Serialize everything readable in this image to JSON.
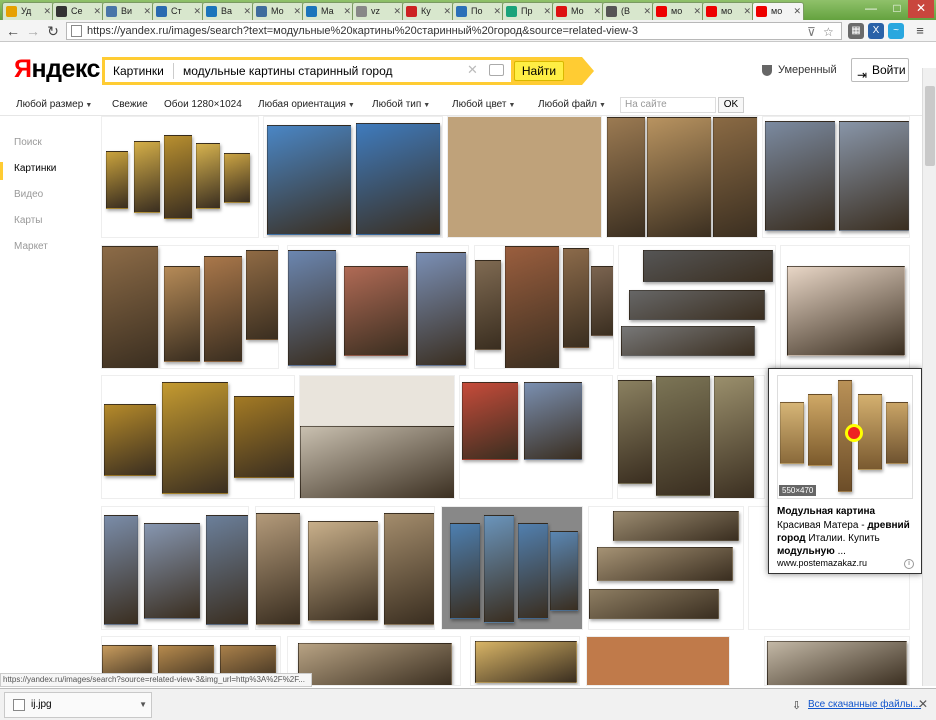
{
  "browser": {
    "tabs": [
      {
        "label": "Уд",
        "color": "#e6a100"
      },
      {
        "label": "Се",
        "color": "#333"
      },
      {
        "label": "Ви",
        "color": "#4a76a8"
      },
      {
        "label": "Ст",
        "color": "#2a6bb0"
      },
      {
        "label": "Ва",
        "color": "#1b75bb"
      },
      {
        "label": "Мо",
        "color": "#3f6d9d"
      },
      {
        "label": "Ма",
        "color": "#1b75bb"
      },
      {
        "label": "vz",
        "color": "#888"
      },
      {
        "label": "Ку",
        "color": "#cc2222"
      },
      {
        "label": "По",
        "color": "#2b71b8"
      },
      {
        "label": "Пр",
        "color": "#1aa37a"
      },
      {
        "label": "Мо",
        "color": "#d11"
      },
      {
        "label": "(В",
        "color": "#555"
      },
      {
        "label": "мо",
        "color": "#e00"
      },
      {
        "label": "мо",
        "color": "#e00"
      },
      {
        "label": "мо",
        "color": "#e00"
      }
    ],
    "url": "https://yandex.ru/images/search?text=модульные%20картины%20старинный%20город&source=related-view-3",
    "window_buttons": {
      "minimize": "—",
      "maximize": "□",
      "close": "✕"
    }
  },
  "header": {
    "logo_first": "Я",
    "logo_rest": "ндекс",
    "service": "Картинки",
    "query": "модульные картины старинный город",
    "find_button": "Найти",
    "safe_search": "Умеренный",
    "login": "Войти"
  },
  "filters": {
    "items": [
      {
        "label": "Любой размер",
        "chev": true
      },
      {
        "label": "Свежие",
        "chev": false
      },
      {
        "label": "Обои 1280×1024",
        "chev": false
      },
      {
        "label": "Любая ориентация",
        "chev": true
      },
      {
        "label": "Любой тип",
        "chev": true
      },
      {
        "label": "Любой цвет",
        "chev": true
      },
      {
        "label": "Любой файл",
        "chev": true
      }
    ],
    "site_placeholder": "На сайте",
    "ok": "OK"
  },
  "sidebar": {
    "items": [
      "Поиск",
      "Картинки",
      "Видео",
      "Карты",
      "Маркет"
    ],
    "active_index": 1
  },
  "popup": {
    "size": "550×470",
    "title": "Модульная картина",
    "desc_1": "Красивая Матера - ",
    "desc_bold_1": "древний город",
    "desc_2": " Италии. Купить ",
    "desc_bold_2": "модульную",
    "desc_3": " ...",
    "site": "www.postemazakaz.ru"
  },
  "status_url": "https://yandex.ru/images/search?source=related-view-3&img_url=http%3A%2F%2F...",
  "downloads": {
    "file": "ij.jpg",
    "all_downloads": "Все скачанные файлы..."
  }
}
